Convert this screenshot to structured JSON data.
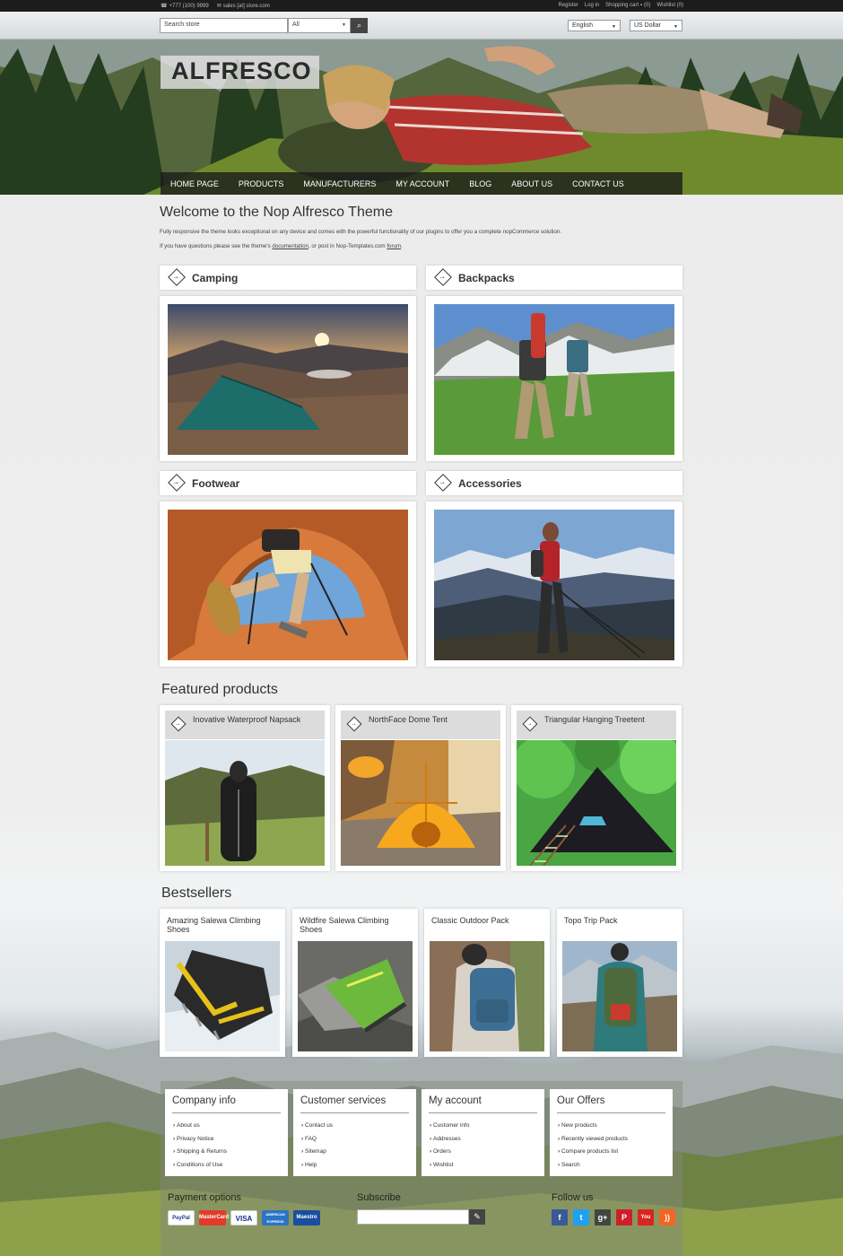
{
  "topbar": {
    "phone": "+777 (100) 9999",
    "email": "sales [at] store.com",
    "register": "Register",
    "login": "Log in",
    "cart": "Shopping cart",
    "cart_count": "(0)",
    "wishlist": "Wishlist (0)"
  },
  "search": {
    "placeholder": "Search store",
    "category": "All"
  },
  "selectors": {
    "language": "English",
    "currency": "US Dollar"
  },
  "logo": "ALFRESCO",
  "nav": [
    "HOME PAGE",
    "PRODUCTS",
    "MANUFACTURERS",
    "MY ACCOUNT",
    "BLOG",
    "ABOUT US",
    "CONTACT US"
  ],
  "welcome": {
    "title": "Welcome to the Nop Alfresco Theme",
    "line1": "Fully responsive the theme looks exceptional on any device and comes with the powerful functionality of our plugins to offer you a complete nopCommerce solution.",
    "line2_pre": "If you have questions please see the theme's ",
    "line2_link1": "documentation",
    "line2_mid": ", or post in Nop-Templates.com ",
    "line2_link2": "forum",
    "line2_end": "."
  },
  "categories": [
    "Camping",
    "Backpacks",
    "Footwear",
    "Accessories"
  ],
  "featured": {
    "title": "Featured products",
    "items": [
      "Inovative Waterproof Napsack",
      "NorthFace Dome Tent",
      "Triangular Hanging Treetent"
    ]
  },
  "bestsellers": {
    "title": "Bestsellers",
    "items": [
      "Amazing Salewa Climbing Shoes",
      "Wildfire Salewa Climbing Shoes",
      "Classic Outdoor Pack",
      "Topo Trip Pack"
    ]
  },
  "footer": {
    "columns": [
      {
        "title": "Company info",
        "links": [
          "About us",
          "Privacy Notice",
          "Shipping & Returns",
          "Conditions of Use"
        ]
      },
      {
        "title": "Customer services",
        "links": [
          "Contact us",
          "FAQ",
          "Sitemap",
          "Help"
        ]
      },
      {
        "title": "My account",
        "links": [
          "Customer info",
          "Addresses",
          "Orders",
          "Wishlist"
        ]
      },
      {
        "title": "Our Offers",
        "links": [
          "New products",
          "Recently viewed products",
          "Compare products list",
          "Search"
        ]
      }
    ],
    "payment_title": "Payment options",
    "payments": [
      "PayPal",
      "MasterCard",
      "VISA",
      "AMERICAN EXPRESS",
      "Maestro"
    ],
    "subscribe_title": "Subscribe",
    "follow_title": "Follow us",
    "social": [
      {
        "name": "facebook",
        "glyph": "f",
        "color": "#3b5998"
      },
      {
        "name": "twitter",
        "glyph": "t",
        "color": "#1da1f2"
      },
      {
        "name": "google-plus",
        "glyph": "g+",
        "color": "#444"
      },
      {
        "name": "pinterest",
        "glyph": "P",
        "color": "#cb2027"
      },
      {
        "name": "youtube",
        "glyph": "You",
        "color": "#d9251d"
      },
      {
        "name": "rss",
        "glyph": "))",
        "color": "#f26522"
      }
    ]
  },
  "colors": {
    "topbar": "#1c1c1c",
    "nav_bg": "#1e1e1e",
    "accent_text": "#333333"
  }
}
